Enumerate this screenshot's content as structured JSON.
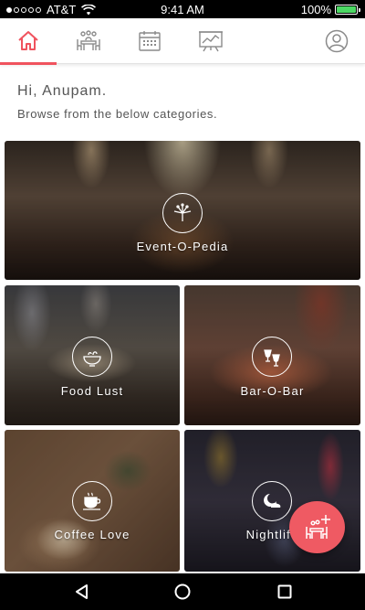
{
  "status_bar": {
    "carrier": "AT&T",
    "time": "9:41 AM",
    "battery": "100%",
    "battery_level": 1.0,
    "battery_color": "#4cd964",
    "signal_dots_filled": 1,
    "signal_dots_total": 5
  },
  "top_nav": {
    "accent_color": "#f0535e",
    "items": [
      {
        "icon": "home-icon",
        "active": true
      },
      {
        "icon": "dining-table-icon",
        "active": false
      },
      {
        "icon": "calendar-icon",
        "active": false
      },
      {
        "icon": "analytics-board-icon",
        "active": false
      },
      {
        "icon": "user-profile-icon",
        "active": false
      }
    ]
  },
  "greeting": {
    "hello": "Hi, Anupam.",
    "subtitle": "Browse from the below categories."
  },
  "categories": [
    {
      "label": "Event-O-Pedia",
      "icon": "fireworks-icon"
    },
    {
      "label": "Food Lust",
      "icon": "food-bowl-icon"
    },
    {
      "label": "Bar-O-Bar",
      "icon": "cocktail-glasses-icon"
    },
    {
      "label": "Coffee Love",
      "icon": "coffee-cup-icon"
    },
    {
      "label": "Nightlife",
      "icon": "moon-night-icon"
    }
  ],
  "fab": {
    "icon": "add-table-icon",
    "color": "#ef5a63"
  },
  "android_nav": {
    "icons": [
      "back-icon",
      "home-circle-icon",
      "recents-icon"
    ]
  }
}
